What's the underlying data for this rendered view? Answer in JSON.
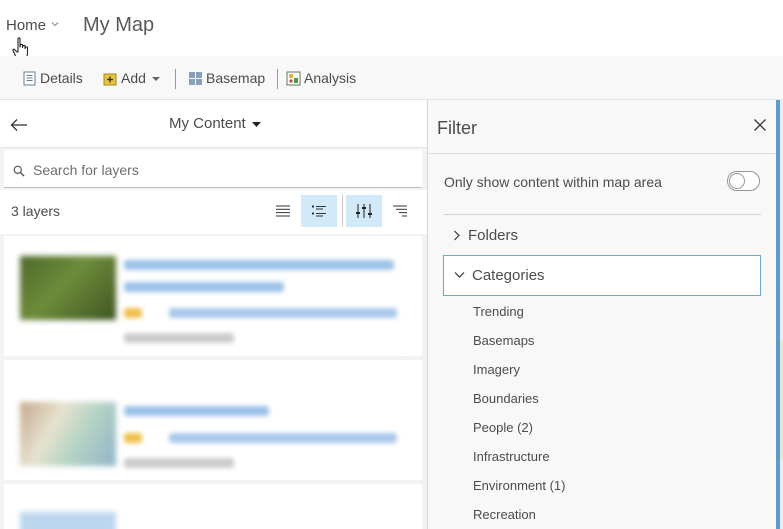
{
  "header": {
    "home_label": "Home",
    "map_title": "My Map"
  },
  "toolbar": {
    "details_label": "Details",
    "add_label": "Add",
    "basemap_label": "Basemap",
    "analysis_label": "Analysis"
  },
  "content_panel": {
    "title": "My Content",
    "search_placeholder": "Search for layers",
    "layer_count": "3 layers",
    "layers": [
      {
        "title": "",
        "owner": "",
        "updated": ""
      },
      {
        "title": "",
        "owner": "",
        "updated": ""
      },
      {
        "title": "",
        "owner": "",
        "updated": ""
      }
    ]
  },
  "filter_panel": {
    "title": "Filter",
    "toggle_label": "Only show content within map area",
    "toggle_on": false,
    "folders_label": "Folders",
    "categories_label": "Categories",
    "categories": [
      "Trending",
      "Basemaps",
      "Imagery",
      "Boundaries",
      "People (2)",
      "Infrastructure",
      "Environment (1)",
      "Recreation"
    ]
  },
  "colors": {
    "accent": "#0079c1",
    "active_button_bg": "#d2e9f9",
    "selected_border": "#6ba7d8"
  }
}
